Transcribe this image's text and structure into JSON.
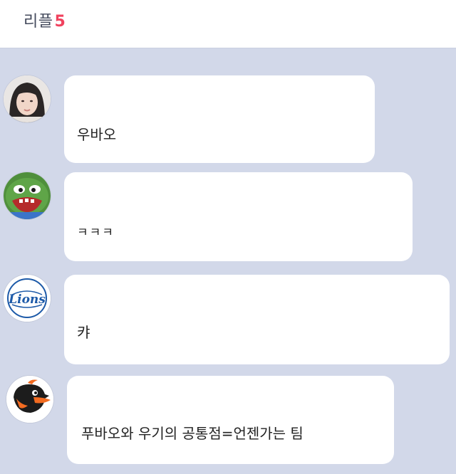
{
  "header": {
    "title": "리플",
    "count": "5"
  },
  "replies": [
    {
      "avatar": "girl-photo-avatar",
      "text": "우바오"
    },
    {
      "avatar": "pepe-frog-avatar",
      "text": "ㅋㅋㅋ"
    },
    {
      "avatar": "lions-logo-avatar",
      "text": "캬",
      "logo_text": "Lions"
    },
    {
      "avatar": "orioles-bird-avatar",
      "text": "푸바오와 우기의 공통점=언젠가는 팀"
    }
  ],
  "colors": {
    "background": "#d2d8e9",
    "bubble": "#ffffff",
    "accent_count": "#f0425e",
    "title": "#444a5c"
  }
}
